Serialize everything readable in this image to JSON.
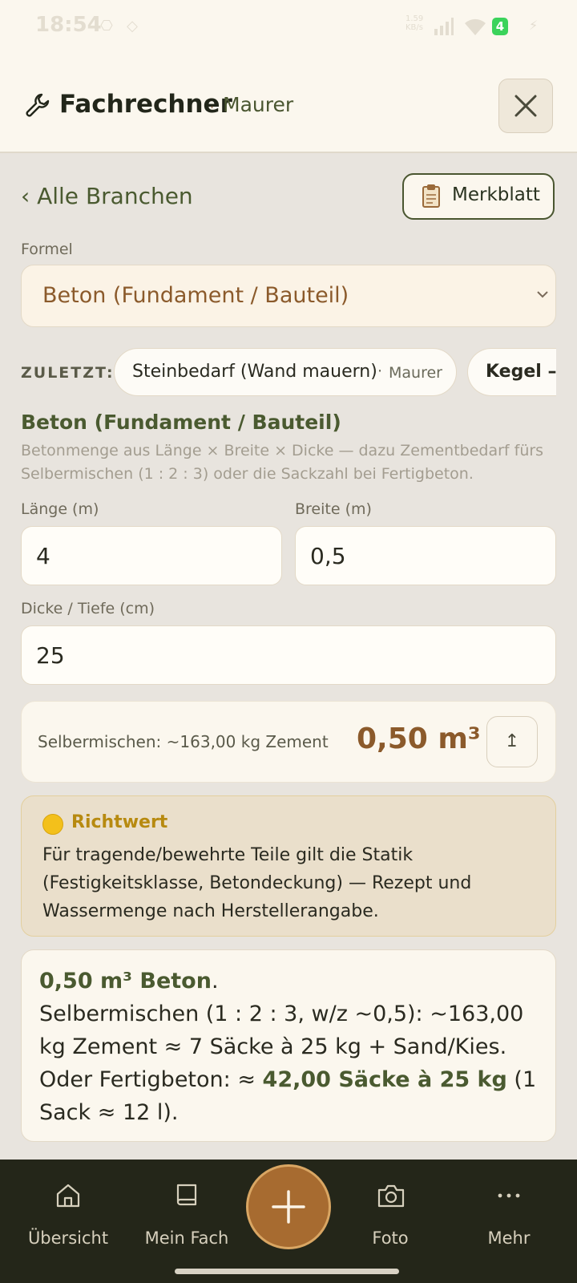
{
  "status_bar": {
    "time": "18:54",
    "network": "1.59\nKB/s",
    "battery": "4"
  },
  "header": {
    "title": "Fachrechner",
    "separator": "·",
    "subtitle": "Maurer"
  },
  "nav_back": {
    "label": "‹ Alle Branchen"
  },
  "merkblatt": {
    "label": "Merkblatt"
  },
  "formula": {
    "label": "Formel",
    "selected": "Beton (Fundament / Bauteil)"
  },
  "recent": {
    "label": "ZULETZT:",
    "chips": [
      {
        "main": "Steinbedarf (Wand mauern)",
        "sep": "·",
        "sub": "Maurer"
      },
      {
        "main": "Kegel – V"
      }
    ]
  },
  "calc": {
    "title": "Beton (Fundament / Bauteil)",
    "description": "Betonmenge aus Länge × Breite × Dicke — dazu Zementbedarf fürs Selbermischen (1 : 2 : 3) oder die Sackzahl bei Fertigbeton."
  },
  "fields": {
    "laenge": {
      "label": "Länge (m)",
      "value": "4"
    },
    "breite": {
      "label": "Breite (m)",
      "value": "0,5"
    },
    "dicke": {
      "label": "Dicke / Tiefe (cm)",
      "value": "25"
    }
  },
  "result": {
    "text": "Selbermischen: ~163,00 kg Zement",
    "value": "0,50 m³",
    "share_icon": "↥"
  },
  "note": {
    "title": "Richtwert",
    "body": "Für tragende/bewehrte Teile gilt die Statik (Festigkeitsklasse, Betondeckung) — Rezept und Wassermenge nach Herstellerangabe."
  },
  "summary": {
    "bold1": "0,50 m³ Beton",
    "t1": ".",
    "t2": "Selbermischen (1 : 2 : 3, w/z ~0,5): ~163,00 kg Zement ≈ 7 Säcke à 25 kg + Sand/Kies.",
    "t3": "Oder Fertigbeton: ≈ ",
    "bold2": "42,00 Säcke à 25 kg",
    "t4": " (1 Sack ≈ 12 l)."
  },
  "bottom_nav": {
    "items": [
      {
        "label": "Übersicht",
        "icon": "home-icon"
      },
      {
        "label": "Mein Fach",
        "icon": "book-icon"
      },
      {
        "label": "Foto",
        "icon": "camera-icon"
      },
      {
        "label": "Mehr",
        "icon": "more-icon"
      }
    ],
    "fab_icon": "plus-icon"
  },
  "colors": {
    "accent": "#4a5a30",
    "brand_brown": "#8b5a2b",
    "nav_bg": "#242619",
    "fab": "#a76b30"
  }
}
